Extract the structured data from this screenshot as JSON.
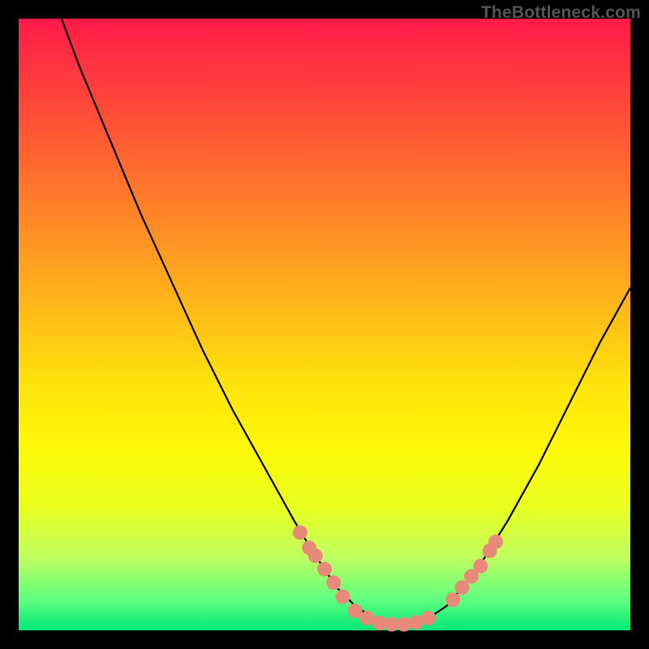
{
  "watermark": "TheBottleneck.com",
  "chart_data": {
    "type": "line",
    "title": "",
    "xlabel": "",
    "ylabel": "",
    "xlim": [
      0,
      100
    ],
    "ylim": [
      0,
      100
    ],
    "series": [
      {
        "name": "curve",
        "x": [
          7,
          10,
          15,
          20,
          25,
          30,
          35,
          40,
          45,
          48,
          50,
          52,
          55,
          58,
          60,
          63,
          67,
          70,
          75,
          80,
          85,
          90,
          95,
          100
        ],
        "y": [
          100,
          92,
          80,
          68,
          57,
          46,
          36,
          27,
          18,
          13,
          10,
          7,
          4,
          2,
          1,
          1,
          2,
          4,
          10,
          18,
          27,
          37,
          47,
          56
        ]
      }
    ],
    "markers": [
      {
        "x": 46,
        "y": 16,
        "r": 1.6
      },
      {
        "x": 47.5,
        "y": 13.5,
        "r": 1.6
      },
      {
        "x": 48.5,
        "y": 12.2,
        "r": 1.6
      },
      {
        "x": 50,
        "y": 10,
        "r": 1.6
      },
      {
        "x": 51.5,
        "y": 7.8,
        "r": 1.6
      },
      {
        "x": 53,
        "y": 5.5,
        "r": 1.6
      },
      {
        "x": 55,
        "y": 3.2,
        "r": 1.6
      },
      {
        "x": 57,
        "y": 2.0,
        "r": 1.6
      },
      {
        "x": 59,
        "y": 1.2,
        "r": 1.6
      },
      {
        "x": 61,
        "y": 1.0,
        "r": 1.6
      },
      {
        "x": 63,
        "y": 1.0,
        "r": 1.6
      },
      {
        "x": 65,
        "y": 1.3,
        "r": 1.6
      },
      {
        "x": 67,
        "y": 2.0,
        "r": 1.6
      },
      {
        "x": 71,
        "y": 5.0,
        "r": 1.6
      },
      {
        "x": 72.5,
        "y": 7.0,
        "r": 1.6
      },
      {
        "x": 74,
        "y": 8.8,
        "r": 1.6
      },
      {
        "x": 75.5,
        "y": 10.5,
        "r": 1.6
      },
      {
        "x": 77,
        "y": 13.0,
        "r": 1.6
      },
      {
        "x": 78,
        "y": 14.5,
        "r": 1.6
      }
    ],
    "gradient_stops": [
      {
        "offset": 0,
        "color": "#ff1a48"
      },
      {
        "offset": 50,
        "color": "#ffc216"
      },
      {
        "offset": 100,
        "color": "#00e878"
      }
    ]
  }
}
